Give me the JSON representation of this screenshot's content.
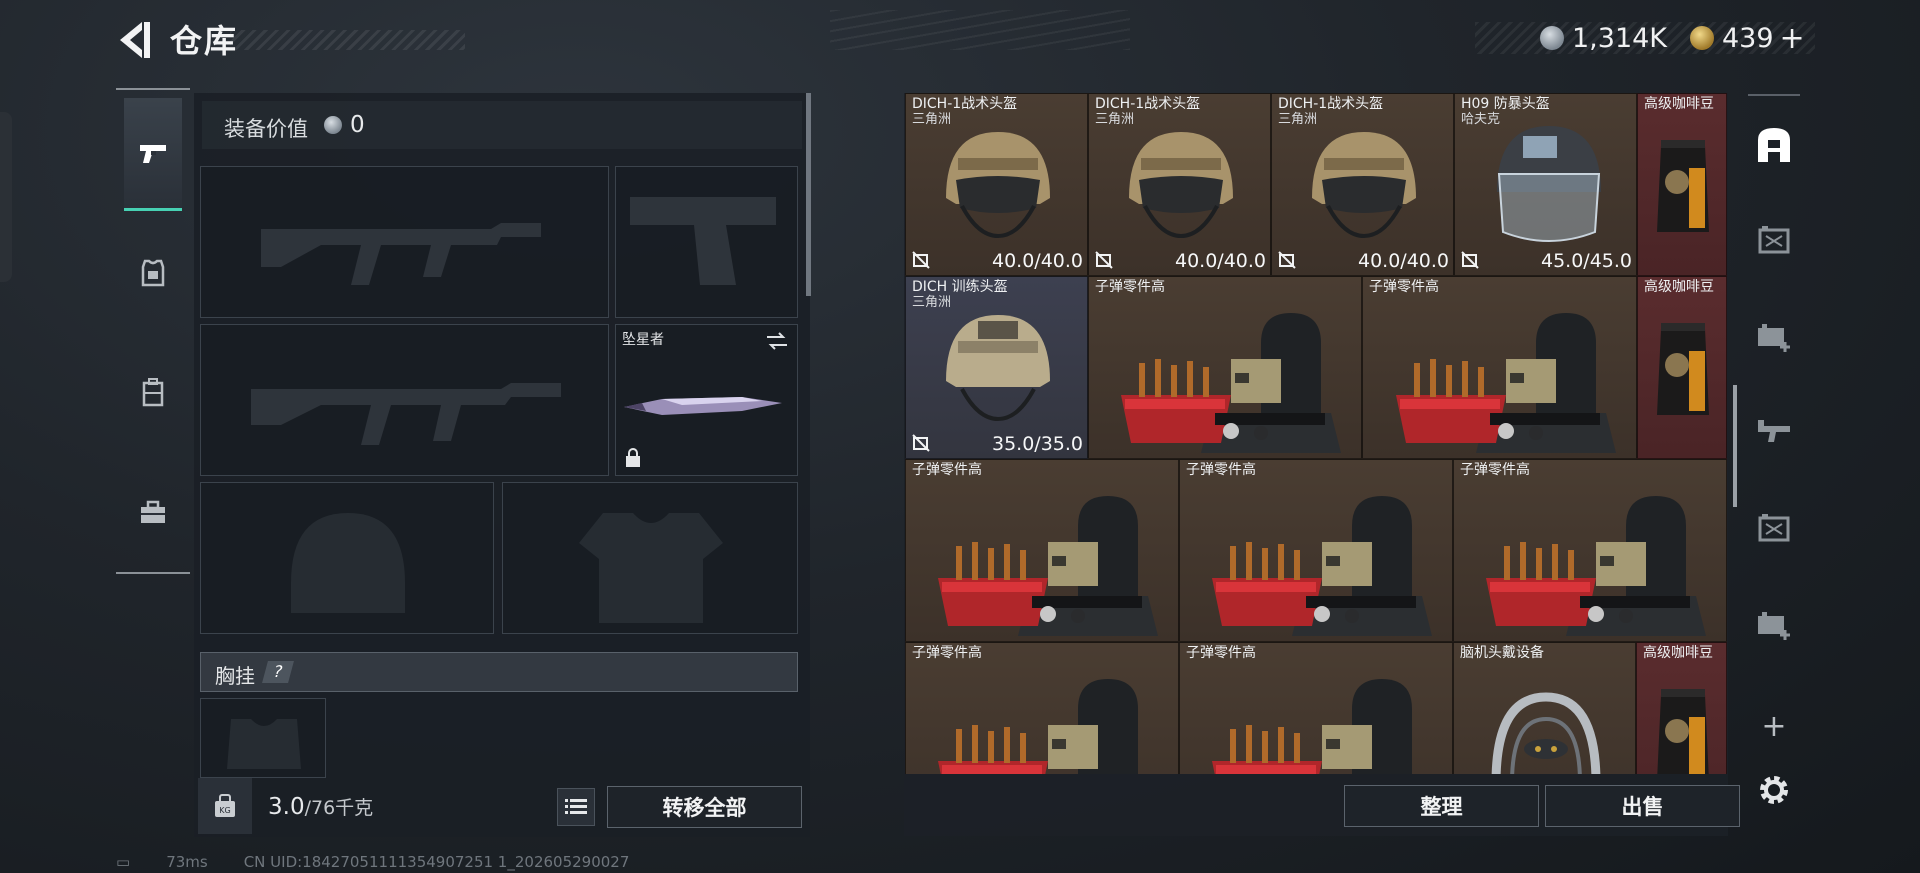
{
  "header": {
    "title": "仓库",
    "currencies": [
      {
        "icon": "silver-coin-icon",
        "value": "1,314K"
      },
      {
        "icon": "gold-coin-icon",
        "value": "439",
        "plus": "+"
      }
    ]
  },
  "left_nav": {
    "items": [
      {
        "name": "weapons",
        "icon": "pistol-icon",
        "active": true
      },
      {
        "name": "armor",
        "icon": "armor-icon",
        "active": false
      },
      {
        "name": "backpack",
        "icon": "backpack-icon",
        "active": false
      },
      {
        "name": "toolbox",
        "icon": "toolbox-icon",
        "active": false
      }
    ]
  },
  "equipment": {
    "value_label": "装备价值",
    "value": "0",
    "melee_label": "坠星者",
    "chest_rig_label": "胸挂",
    "chest_rig_help": "?"
  },
  "footer_left": {
    "weight_current": "3.0",
    "weight_max": "/76千克",
    "transfer_all_label": "转移全部"
  },
  "footer_right": {
    "sort_label": "整理",
    "sell_label": "出售"
  },
  "stash": {
    "items": [
      {
        "name": "DICH-1战术头盔",
        "sub": "三角洲",
        "durability": "40.0/40.0",
        "bg": "brown",
        "art": "helmet-tan"
      },
      {
        "name": "DICH-1战术头盔",
        "sub": "三角洲",
        "durability": "40.0/40.0",
        "bg": "brown",
        "art": "helmet-tan"
      },
      {
        "name": "DICH-1战术头盔",
        "sub": "三角洲",
        "durability": "40.0/40.0",
        "bg": "brown",
        "art": "helmet-tan"
      },
      {
        "name": "H09 防暴头盔",
        "sub": "哈夫克",
        "durability": "45.0/45.0",
        "bg": "brown",
        "art": "helmet-riot"
      },
      {
        "name": "高级咖啡豆",
        "sub": "",
        "durability": "",
        "bg": "red",
        "art": "coffee"
      },
      {
        "name": "DICH 训练头盔",
        "sub": "三角洲",
        "durability": "35.0/35.0",
        "bg": "blue",
        "art": "helmet-camo"
      },
      {
        "name": "子弹零件高",
        "sub": "",
        "durability": "",
        "bg": "brown",
        "art": "ammo-parts"
      },
      {
        "name": "子弹零件高",
        "sub": "",
        "durability": "",
        "bg": "brown",
        "art": "ammo-parts"
      },
      {
        "name": "高级咖啡豆",
        "sub": "",
        "durability": "",
        "bg": "red",
        "art": "coffee"
      },
      {
        "name": "子弹零件高",
        "sub": "",
        "durability": "",
        "bg": "brown",
        "art": "ammo-parts"
      },
      {
        "name": "子弹零件高",
        "sub": "",
        "durability": "",
        "bg": "brown",
        "art": "ammo-parts"
      },
      {
        "name": "子弹零件高",
        "sub": "",
        "durability": "",
        "bg": "brown",
        "art": "ammo-parts"
      },
      {
        "name": "子弹零件高",
        "sub": "",
        "durability": "",
        "bg": "brown",
        "art": "ammo-parts"
      },
      {
        "name": "子弹零件高",
        "sub": "",
        "durability": "",
        "bg": "brown",
        "art": "ammo-parts"
      },
      {
        "name": "脑机头戴设备",
        "sub": "",
        "durability": "",
        "bg": "brown",
        "art": "headset"
      },
      {
        "name": "高级咖啡豆",
        "sub": "",
        "durability": "",
        "bg": "red",
        "art": "coffee"
      }
    ]
  },
  "right_rail": {
    "items": [
      {
        "icon": "stash-home-icon",
        "active": true
      },
      {
        "icon": "container-icon",
        "active": false
      },
      {
        "icon": "add-container-icon",
        "active": false
      },
      {
        "icon": "weapon-case-icon",
        "active": false
      },
      {
        "icon": "container-icon",
        "active": false
      },
      {
        "icon": "add-container-icon",
        "active": false
      }
    ],
    "add_label": "+"
  },
  "status_bar": {
    "ping": "73ms",
    "uid": "CN UID:18427051111354907251 1_202605290027"
  },
  "colors": {
    "accent": "#47d1b3",
    "item_bg_brown": "#45392f",
    "item_bg_blue": "#3a3d4c",
    "item_bg_red": "#55292b"
  }
}
